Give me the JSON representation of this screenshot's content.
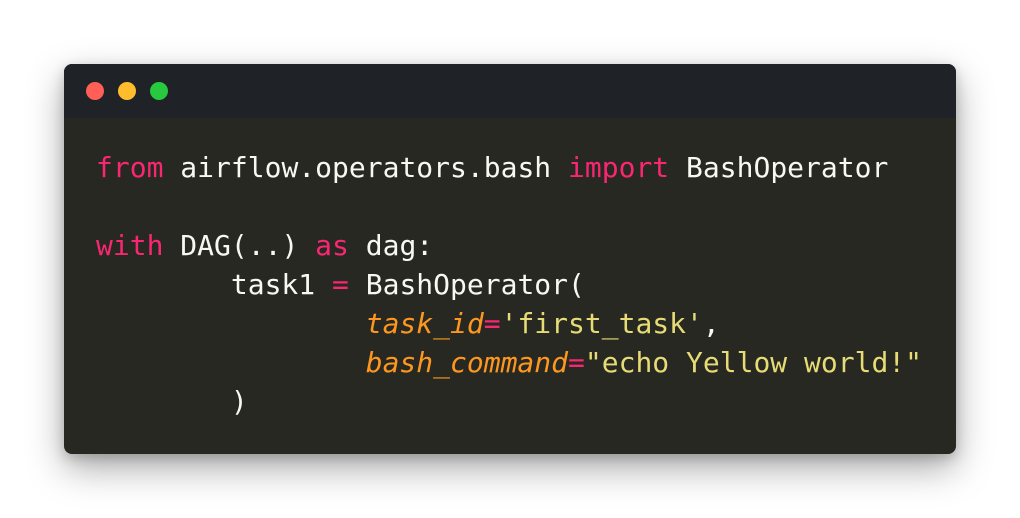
{
  "window": {
    "colors": {
      "background": "#272822",
      "titlebar": "#1f2227"
    },
    "controls": [
      {
        "name": "close",
        "color": "#ff5f56"
      },
      {
        "name": "minimize",
        "color": "#ffbd2e"
      },
      {
        "name": "maximize",
        "color": "#27c93f"
      }
    ]
  },
  "code": {
    "lines": [
      {
        "tokens": [
          {
            "text": "from",
            "type": "kw"
          },
          {
            "text": " airflow.operators.bash ",
            "type": "plain"
          },
          {
            "text": "import",
            "type": "kw"
          },
          {
            "text": " BashOperator",
            "type": "plain"
          }
        ]
      },
      {
        "tokens": []
      },
      {
        "tokens": [
          {
            "text": "with",
            "type": "kw"
          },
          {
            "text": " DAG(..) ",
            "type": "plain"
          },
          {
            "text": "as",
            "type": "kw"
          },
          {
            "text": " dag:",
            "type": "plain"
          }
        ]
      },
      {
        "tokens": [
          {
            "text": "        task1 ",
            "type": "plain"
          },
          {
            "text": "=",
            "type": "op"
          },
          {
            "text": " BashOperator(",
            "type": "plain"
          }
        ]
      },
      {
        "tokens": [
          {
            "text": "                ",
            "type": "plain"
          },
          {
            "text": "task_id",
            "type": "param"
          },
          {
            "text": "=",
            "type": "op"
          },
          {
            "text": "'first_task'",
            "type": "str"
          },
          {
            "text": ",",
            "type": "plain"
          }
        ]
      },
      {
        "tokens": [
          {
            "text": "                ",
            "type": "plain"
          },
          {
            "text": "bash_command",
            "type": "param"
          },
          {
            "text": "=",
            "type": "op"
          },
          {
            "text": "\"echo Yellow world!\"",
            "type": "str"
          }
        ]
      },
      {
        "tokens": [
          {
            "text": "        )",
            "type": "plain"
          }
        ]
      }
    ]
  }
}
